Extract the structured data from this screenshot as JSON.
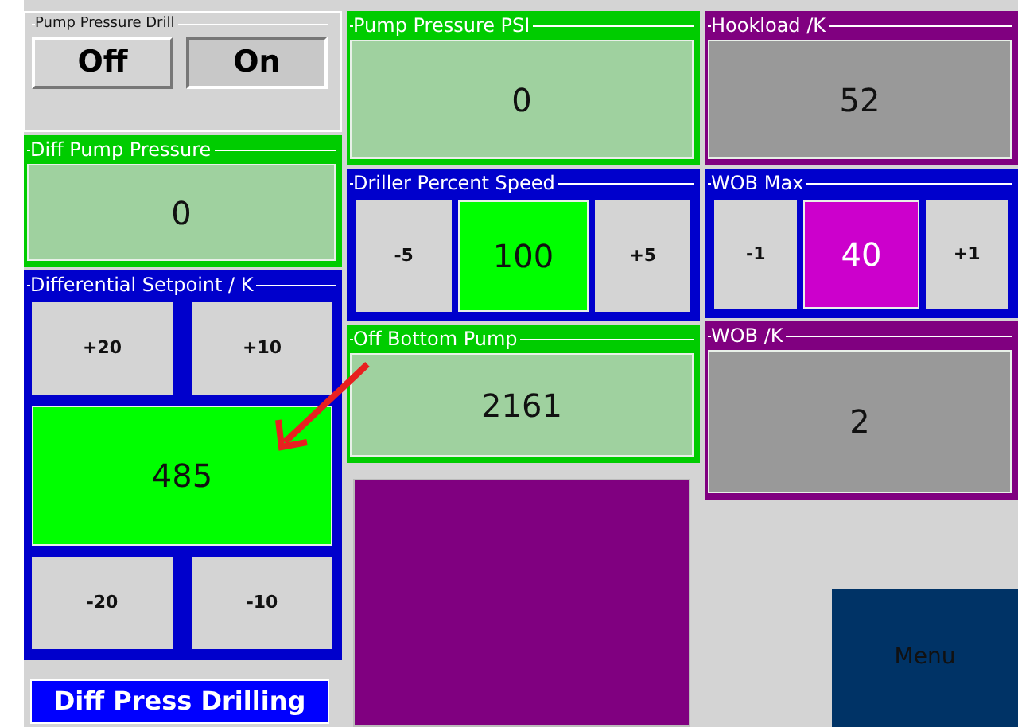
{
  "columns": [
    {
      "items": [
        {
          "kind": "toggle",
          "title": "Pump Pressure Drill",
          "buttons": [
            {
              "label": "Off",
              "selected": false
            },
            {
              "label": "On",
              "selected": true
            }
          ]
        },
        {
          "kind": "display",
          "title": "Diff Pump Pressure",
          "color": "#00cc00",
          "value": "0"
        },
        {
          "kind": "setpoint",
          "title": "Differential  Setpoint / K",
          "color": "#0000cc",
          "top_buttons": [
            "+20",
            "+10"
          ],
          "value": {
            "text": "485",
            "color": "#00ff00"
          },
          "bottom_buttons": [
            "-20",
            "-10"
          ]
        },
        {
          "kind": "banner",
          "text": "Diff Press Drilling",
          "color": "#0000ff"
        }
      ]
    },
    {
      "items": [
        {
          "kind": "display",
          "title": "Pump Pressure PSI",
          "color": "#00cc00",
          "value": "0"
        },
        {
          "kind": "stepper",
          "title": "Driller Percent Speed",
          "color": "#0000cc",
          "buttons": [
            "-5",
            "+5"
          ],
          "value": {
            "text": "100",
            "color": "#00ff00"
          }
        },
        {
          "kind": "display",
          "title": "Off Bottom Pump",
          "color": "#00cc00",
          "value": "2161"
        },
        {
          "kind": "block",
          "color": "#800080"
        }
      ]
    },
    {
      "items": [
        {
          "kind": "display",
          "title": "Hookload /K",
          "color": "#800080",
          "value": "52"
        },
        {
          "kind": "stepper",
          "title": "WOB Max",
          "color": "#0000cc",
          "buttons": [
            "-1",
            "+1"
          ],
          "value": {
            "text": "40",
            "color": "#cc00cc"
          }
        },
        {
          "kind": "display",
          "title": "WOB /K",
          "color": "#800080",
          "value": "2"
        },
        {
          "kind": "button",
          "text": "Menu",
          "color": "#003366"
        }
      ]
    }
  ]
}
